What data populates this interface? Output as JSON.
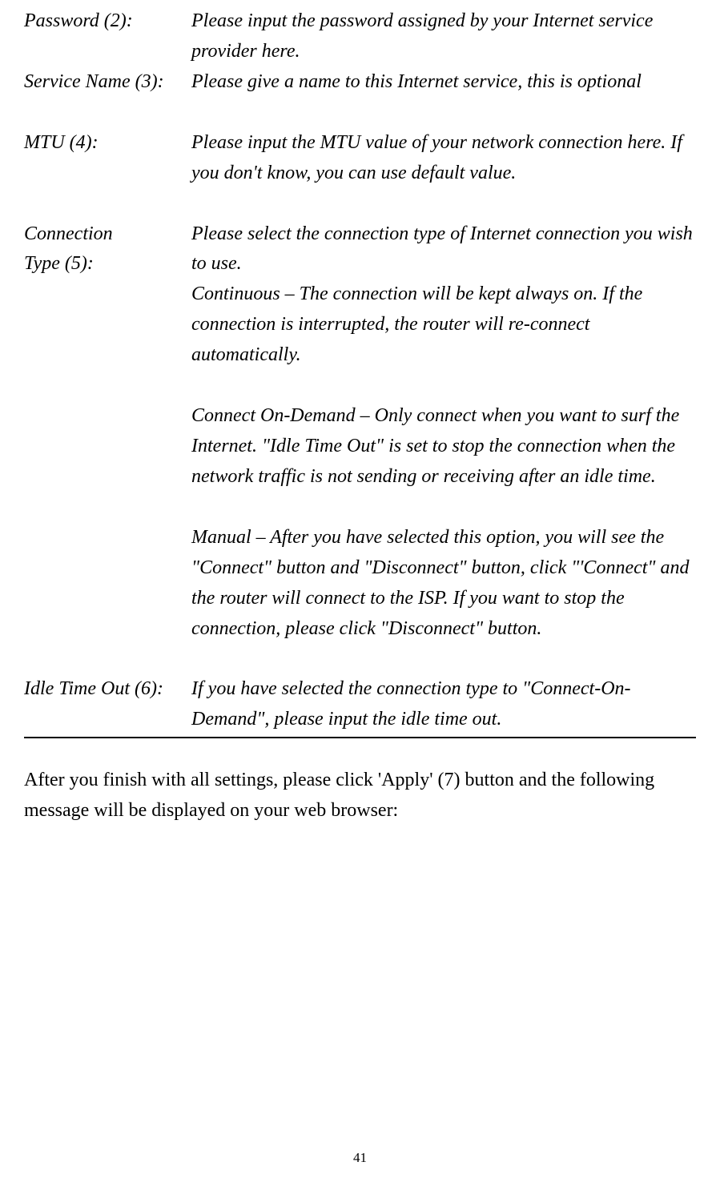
{
  "definitions": {
    "password": {
      "label": "Password (2):",
      "desc": "Please input the password assigned by your Internet service provider here."
    },
    "service_name": {
      "label": "Service Name (3):",
      "desc": "Please give a name to this Internet service, this is optional"
    },
    "mtu": {
      "label": "MTU (4):",
      "desc": "Please input the MTU value of your network connection here. If you don't know, you can use default value."
    },
    "connection_type": {
      "label_line1": "Connection",
      "label_line2": "Type (5):",
      "p1": "Please select the connection type of Internet connection you wish to use.",
      "p2": "Continuous – The connection will be kept always on. If the connection is interrupted, the router will re-connect automatically.",
      "p3": "Connect On-Demand – Only connect when you want to surf the Internet. \"Idle Time Out\" is set to stop the connection when the network traffic is not sending or receiving after an idle time.",
      "p4": "Manual – After you have selected this option, you will see the \"Connect\" button and \"Disconnect\" button, click \"'Connect\" and the router will connect to the ISP. If you want to stop the connection, please click \"Disconnect\" button."
    },
    "idle_time_out": {
      "label": "Idle Time Out (6):",
      "desc": "If you have selected the connection type to \"Connect-On-Demand\", please input the idle time out."
    }
  },
  "after_note": "After you finish with all settings, please click 'Apply' (7) button and the following message will be displayed on your web browser:",
  "page_number": "41"
}
